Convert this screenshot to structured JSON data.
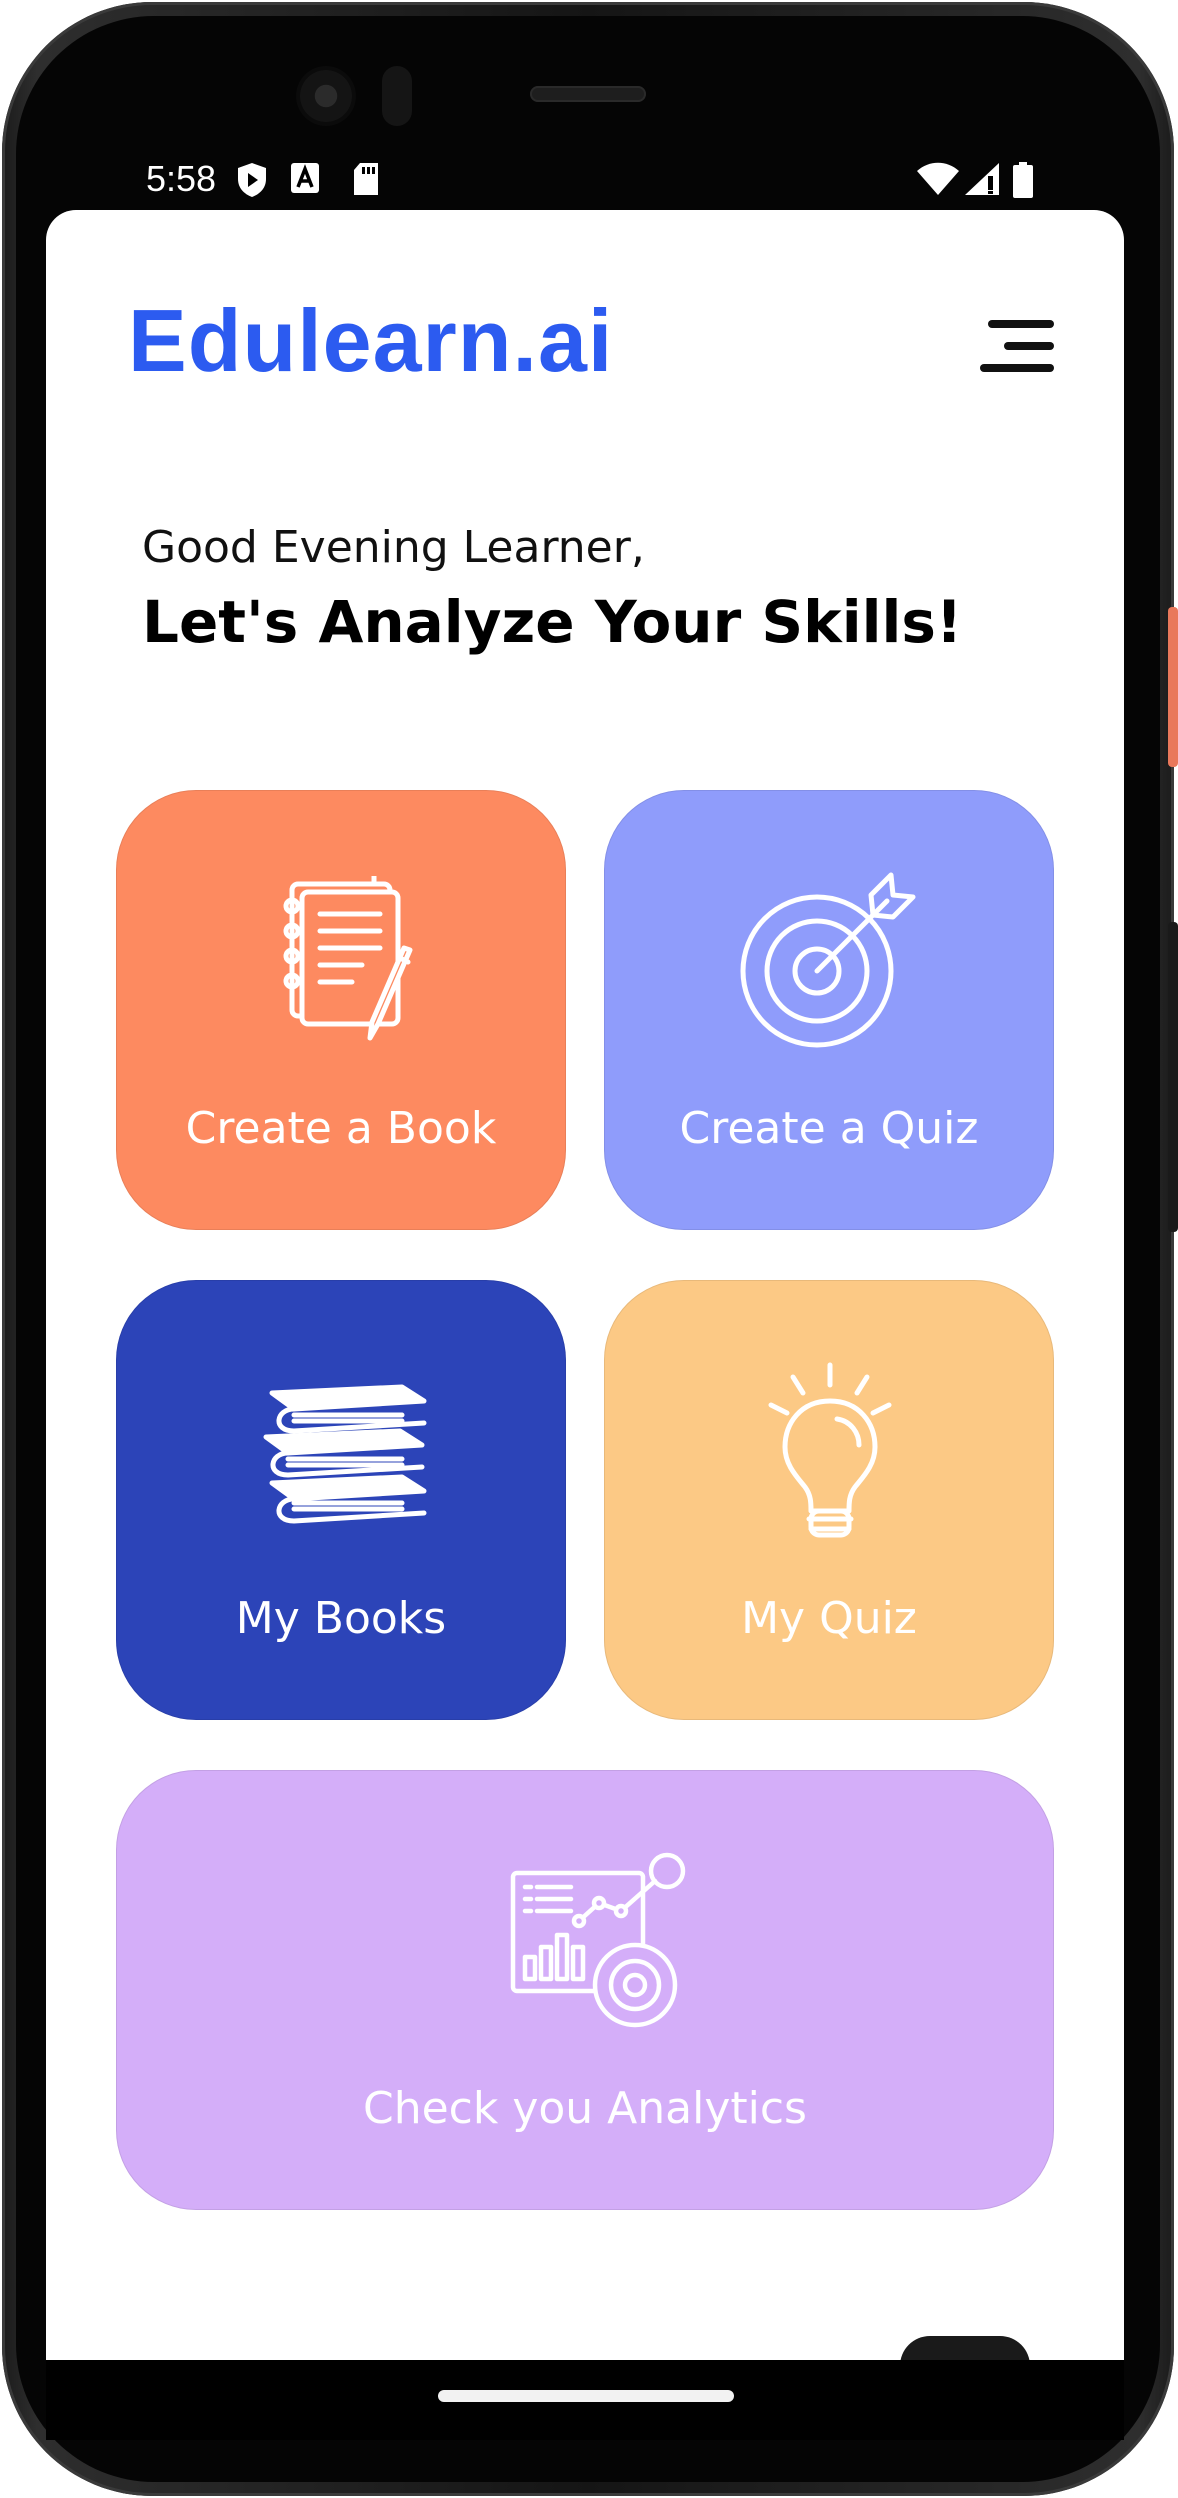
{
  "statusbar": {
    "time": "5:58"
  },
  "header": {
    "logo": "Edulearn.ai"
  },
  "intro": {
    "greeting": "Good Evening Learner,",
    "headline": "Let's Analyze Your Skills!"
  },
  "cards": [
    {
      "label": "Create a Book",
      "icon": "notebook-pencil-icon",
      "color": "#fd8a60"
    },
    {
      "label": "Create a Quiz",
      "icon": "target-arrow-icon",
      "color": "#8f9cfb"
    },
    {
      "label": "My Books",
      "icon": "books-stack-icon",
      "color": "#2c44b8"
    },
    {
      "label": "My Quiz",
      "icon": "lightbulb-icon",
      "color": "#fcc985"
    },
    {
      "label": "Check you Analytics",
      "icon": "analytics-chart-icon",
      "color": "#d4aef9"
    }
  ],
  "colors": {
    "brand": "#2c5bf0"
  }
}
